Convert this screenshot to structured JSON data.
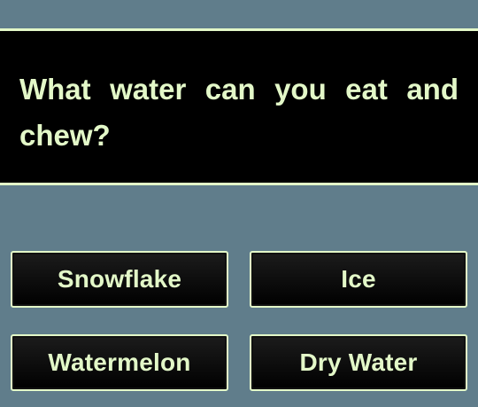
{
  "colors": {
    "background": "#607D8B",
    "panel": "#000000",
    "text_accent": "#E3F8C8"
  },
  "question": {
    "text": "What water can you eat and chew?"
  },
  "answers": [
    {
      "label": "Snowflake"
    },
    {
      "label": "Ice"
    },
    {
      "label": "Watermelon"
    },
    {
      "label": "Dry Water"
    }
  ]
}
